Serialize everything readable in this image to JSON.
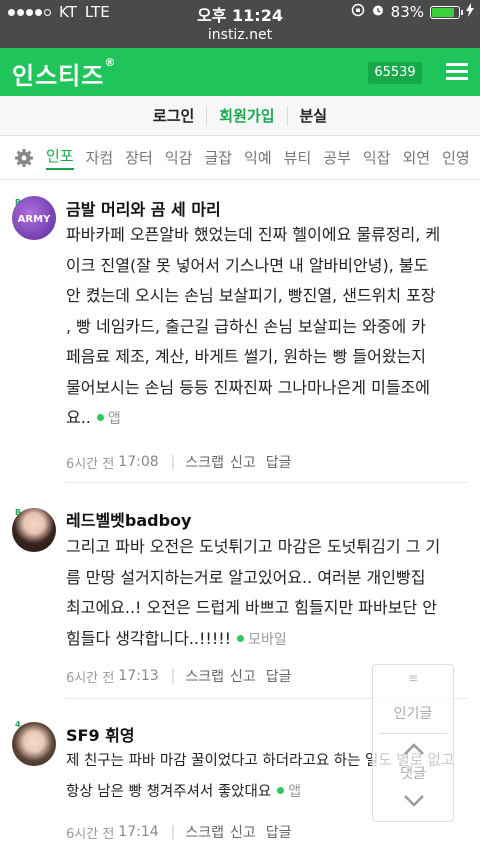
{
  "status_bar": {
    "carrier": "KT",
    "network": "LTE",
    "time": "오후 11:24",
    "battery_percent": "83%",
    "battery_level": 0.83
  },
  "url": "instiz.net",
  "header": {
    "logo": "인스티즈",
    "logo_mark": "®",
    "counter": "65539"
  },
  "auth": {
    "login": "로그인",
    "signup": "회원가입",
    "lost": "분실"
  },
  "categories": [
    "인포",
    "자컴",
    "장터",
    "익감",
    "글잡",
    "익예",
    "뷰티",
    "공부",
    "익잡",
    "외연",
    "인영"
  ],
  "comments": [
    {
      "nickname": "금발 머리와 곰 세 마리",
      "avatar_text": "ARMY",
      "lines": [
        "파바카페 오픈알바 했었는데 진짜 헬이에요 물류정리, 케",
        "이크 진열(잘 못 넣어서 기스나면 내 알바비안녕), 불도",
        "안 켰는데 오시는 손님 보살피기, 빵진열, 샌드위치 포장",
        ", 빵 네임카드, 출근길 급하신 손님 보살피는 와중에 카",
        "페음료 제조, 계산, 바게트 썰기, 원하는 빵 들어왔는지",
        "물어보시는 손님 등등 진짜진짜 그나마나은게 미들조에"
      ],
      "last_line": "요..",
      "device": "앱",
      "ago": "6시간 전",
      "time": "17:08"
    },
    {
      "nickname": "레드벨벳badboy",
      "lines": [
        "그리고 파바 오전은 도넛튀기고 마감은 도넛튀김기 그 기",
        "름 만땅 설거지하는거로 알고있어요.. 여러분 개인빵집",
        "최고에요..! 오전은 드럽게 바쁘고 힘들지만 파바보단 안"
      ],
      "last_line": "힘들다 생각합니다..!!!!!",
      "device": "모바일",
      "ago": "6시간 전",
      "time": "17:13"
    },
    {
      "nickname": "SF9 휘영",
      "lines": [
        "제 친구는 파바 마감 꿀이었다고 하더라고요 하는 일도 별로 없고"
      ],
      "last_line": "항상 남은 빵 챙겨주셔서 좋았대요",
      "device": "앱",
      "ago": "6시간 전",
      "time": "17:14"
    }
  ],
  "actions": {
    "scrap": "스크랩",
    "report": "신고",
    "reply": "답글"
  },
  "float_widget": {
    "grip": "≡",
    "popular": "인기글",
    "comments": "댓글"
  },
  "colors": {
    "brand": "#1fc55a",
    "status_bar": "#4a4a4a",
    "accent_text": "#1aa84e"
  }
}
